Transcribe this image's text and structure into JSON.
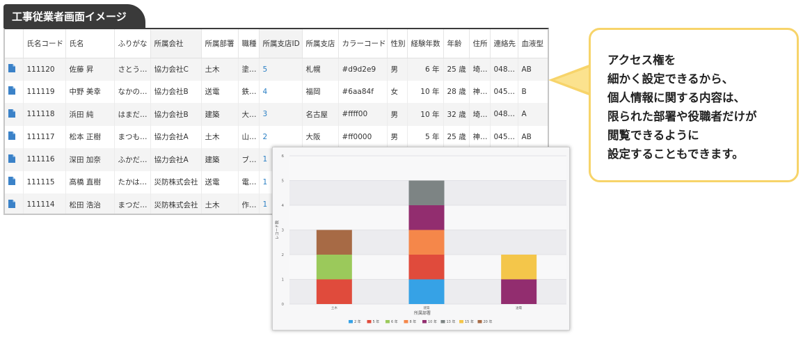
{
  "page_title": "工事従業者画面イメージ",
  "table": {
    "headers": [
      "",
      "氏名コード",
      "氏名",
      "ふりがな",
      "所属会社",
      "所属部署",
      "職種",
      "所属支店ID",
      "所属支店",
      "カラーコード",
      "性別",
      "経験年数",
      "年齢",
      "住所",
      "連絡先",
      "血液型"
    ],
    "rows": [
      [
        "111120",
        "佐藤 昇",
        "さとう…",
        "協力会社C",
        "土木",
        "塗…",
        "5",
        "札幌",
        "#d9d2e9",
        "男",
        "6 年",
        "25 歳",
        "埼…",
        "048…",
        "AB"
      ],
      [
        "111119",
        "中野 美幸",
        "なかの…",
        "協力会社B",
        "送電",
        "鉄…",
        "4",
        "福岡",
        "#6aa84f",
        "女",
        "10 年",
        "28 歳",
        "神…",
        "045…",
        "B"
      ],
      [
        "111118",
        "浜田 純",
        "はまだ…",
        "協力会社B",
        "建築",
        "大…",
        "3",
        "名古屋",
        "#ffff00",
        "男",
        "10 年",
        "32 歳",
        "埼…",
        "048…",
        "A"
      ],
      [
        "111117",
        "松本 正樹",
        "まつも…",
        "協力会社A",
        "土木",
        "山…",
        "2",
        "大阪",
        "#ff0000",
        "男",
        "5 年",
        "25 歳",
        "神…",
        "045…",
        "AB"
      ],
      [
        "111116",
        "深田 加奈",
        "ふかだ…",
        "協力会社A",
        "建築",
        "ブ…",
        "1",
        "",
        "",
        "",
        "",
        "",
        "",
        "",
        ""
      ],
      [
        "111115",
        "高橋 直樹",
        "たかは…",
        "災防株式会社",
        "送電",
        "電…",
        "1",
        "",
        "",
        "",
        "",
        "",
        "",
        "",
        ""
      ],
      [
        "111114",
        "松田 浩治",
        "まつだ…",
        "災防株式会社",
        "土木",
        "作…",
        "1",
        "",
        "",
        "",
        "",
        "",
        "",
        "",
        ""
      ]
    ]
  },
  "callout": {
    "lines": [
      "アクセス権を",
      "細かく設定できるから、",
      "個人情報に関する内容は、",
      "限られた部署や役職者だけが",
      "閲覧できるように",
      "設定することもできます。"
    ]
  },
  "colors": {
    "title_bg": "#3a3a3a",
    "callout_border": "#f7d46a",
    "link": "#2a7fc4",
    "icon": "#3b82c8"
  },
  "chart_data": {
    "type": "bar",
    "stacked": true,
    "categories": [
      "土木",
      "建築",
      "送電"
    ],
    "xlabel": "所属部署",
    "ylabel": "レコード数",
    "ylim": [
      0,
      6
    ],
    "yticks": [
      0,
      1,
      2,
      3,
      4,
      5,
      6
    ],
    "grid": true,
    "legend_position": "bottom",
    "series": [
      {
        "name": "2 年",
        "color": "#36a2e6",
        "values": [
          0,
          1,
          0
        ]
      },
      {
        "name": "5 年",
        "color": "#e04b3c",
        "values": [
          1,
          1,
          0
        ]
      },
      {
        "name": "6 年",
        "color": "#9bc95b",
        "values": [
          1,
          0,
          0
        ]
      },
      {
        "name": "8 年",
        "color": "#f5874a",
        "values": [
          0,
          1,
          0
        ]
      },
      {
        "name": "10 年",
        "color": "#922d6f",
        "values": [
          0,
          1,
          1
        ]
      },
      {
        "name": "13 年",
        "color": "#7d8484",
        "values": [
          0,
          1,
          0
        ]
      },
      {
        "name": "15 年",
        "color": "#f4c64a",
        "values": [
          0,
          0,
          1
        ]
      },
      {
        "name": "20 年",
        "color": "#a76a45",
        "values": [
          1,
          0,
          0
        ]
      }
    ]
  }
}
